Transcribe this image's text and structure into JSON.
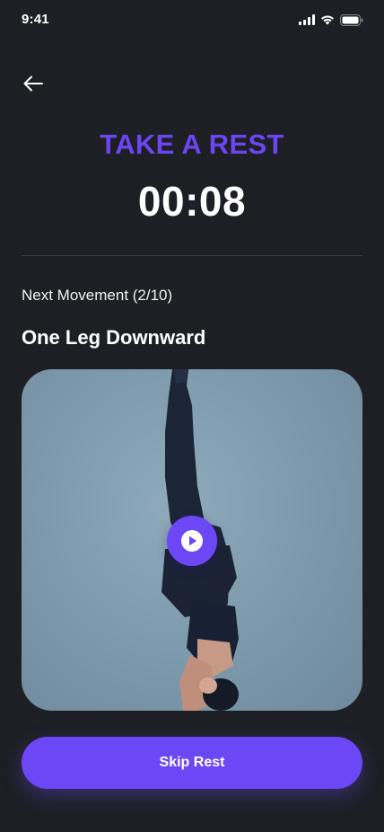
{
  "status_bar": {
    "time": "9:41",
    "icons": [
      "signal-icon",
      "wifi-icon",
      "battery-icon"
    ]
  },
  "header": {
    "back_icon": "arrow-left-icon"
  },
  "rest": {
    "title": "TAKE A REST",
    "timer": "00:08"
  },
  "next_movement": {
    "label": "Next Movement (2/10)",
    "name": "One Leg Downward",
    "play_icon": "play-icon"
  },
  "actions": {
    "skip_label": "Skip Rest"
  },
  "colors": {
    "background": "#1d1f24",
    "accent": "#6c47f5",
    "title": "#6b45f2",
    "divider": "#3a3d45",
    "text": "#ffffff"
  }
}
